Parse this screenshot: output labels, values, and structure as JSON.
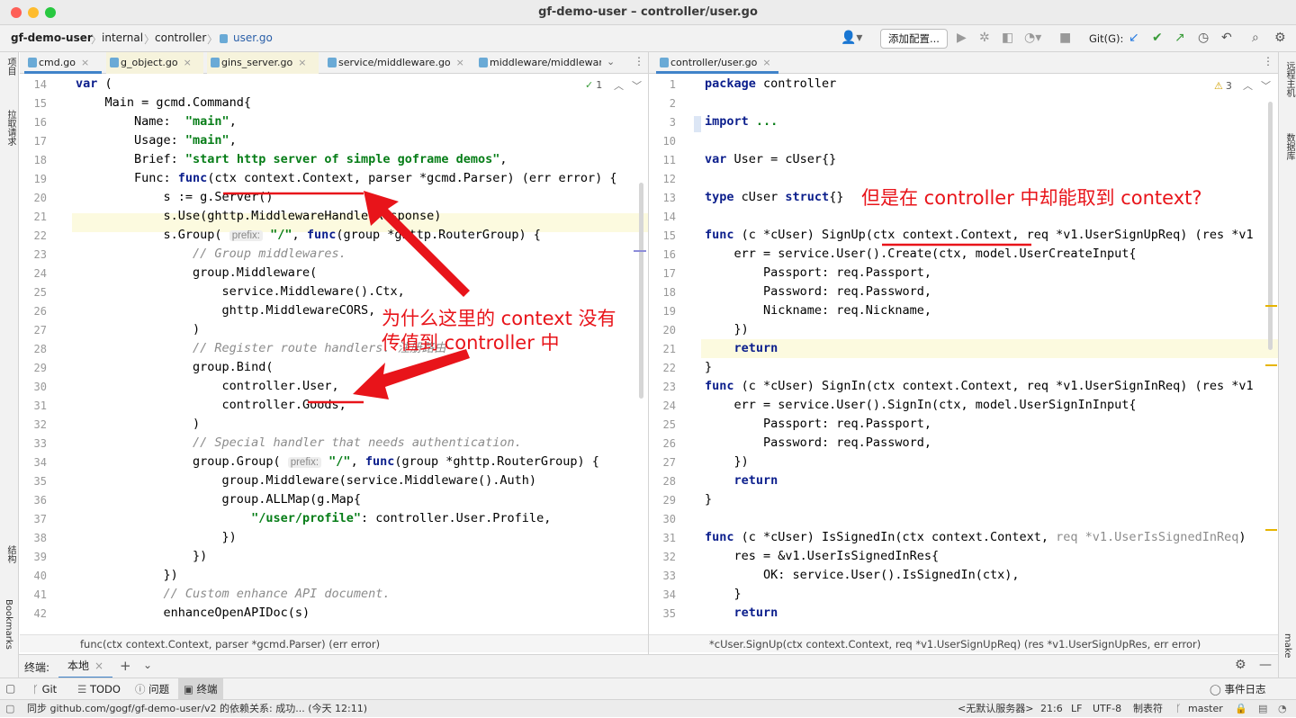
{
  "window": {
    "title": "gf-demo-user – controller/user.go"
  },
  "breadcrumb": [
    "gf-demo-user",
    "internal",
    "controller",
    "user.go"
  ],
  "toolbar": {
    "add_config": "添加配置...",
    "git_label": "Git(G):"
  },
  "left_strip": {
    "project": "项目",
    "pull_requests": "拉取请求",
    "structure": "结构",
    "bookmarks": "Bookmarks"
  },
  "right_strip": {
    "remote_host": "远程主机",
    "database": "数据库",
    "make": "make"
  },
  "left_tabs": [
    {
      "label": "cmd.go"
    },
    {
      "label": "g_object.go"
    },
    {
      "label": "gins_server.go"
    },
    {
      "label": "service/middleware.go"
    },
    {
      "label": "middleware/middlewar"
    }
  ],
  "right_tabs": [
    {
      "label": "controller/user.go"
    }
  ],
  "left_editor": {
    "inspection": "1",
    "current_line": "21",
    "lines": [
      {
        "n": "14",
        "parts": [
          {
            "t": "kw",
            "s": "var"
          },
          {
            "t": "",
            "s": " ("
          }
        ]
      },
      {
        "n": "15",
        "parts": [
          {
            "t": "",
            "s": "    Main = gcmd.Command{"
          }
        ]
      },
      {
        "n": "16",
        "parts": [
          {
            "t": "",
            "s": "        Name:  "
          },
          {
            "t": "str",
            "s": "\"main\""
          },
          {
            "t": "",
            "s": ","
          }
        ]
      },
      {
        "n": "17",
        "parts": [
          {
            "t": "",
            "s": "        Usage: "
          },
          {
            "t": "str",
            "s": "\"main\""
          },
          {
            "t": "",
            "s": ","
          }
        ]
      },
      {
        "n": "18",
        "parts": [
          {
            "t": "",
            "s": "        Brief: "
          },
          {
            "t": "str",
            "s": "\"start http server of simple goframe demos\""
          },
          {
            "t": "",
            "s": ","
          }
        ]
      },
      {
        "n": "19",
        "parts": [
          {
            "t": "",
            "s": "        Func: "
          },
          {
            "t": "kw",
            "s": "func"
          },
          {
            "t": "",
            "s": "(ctx context.Context, parser *gcmd.Parser) (err error) {"
          }
        ]
      },
      {
        "n": "20",
        "parts": [
          {
            "t": "",
            "s": "            s := g.Server()"
          }
        ]
      },
      {
        "n": "21",
        "parts": [
          {
            "t": "",
            "s": "            s.Use(ghttp.MiddlewareHandlerResponse)"
          }
        ]
      },
      {
        "n": "22",
        "parts": [
          {
            "t": "",
            "s": "            s.Group( "
          },
          {
            "t": "hint",
            "s": "prefix:"
          },
          {
            "t": "",
            "s": " "
          },
          {
            "t": "str",
            "s": "\"/\""
          },
          {
            "t": "",
            "s": ", "
          },
          {
            "t": "kw",
            "s": "func"
          },
          {
            "t": "",
            "s": "(group *ghttp.RouterGroup) {"
          }
        ]
      },
      {
        "n": "23",
        "parts": [
          {
            "t": "cmt",
            "s": "                // Group middlewares."
          }
        ]
      },
      {
        "n": "24",
        "parts": [
          {
            "t": "",
            "s": "                group.Middleware("
          }
        ]
      },
      {
        "n": "25",
        "parts": [
          {
            "t": "",
            "s": "                    service.Middleware().Ctx,"
          }
        ]
      },
      {
        "n": "26",
        "parts": [
          {
            "t": "",
            "s": "                    ghttp.MiddlewareCORS,"
          }
        ]
      },
      {
        "n": "27",
        "parts": [
          {
            "t": "",
            "s": "                )"
          }
        ]
      },
      {
        "n": "28",
        "parts": [
          {
            "t": "cmt",
            "s": "                // Register route handlers. 注册路由"
          }
        ]
      },
      {
        "n": "29",
        "parts": [
          {
            "t": "",
            "s": "                group.Bind("
          }
        ]
      },
      {
        "n": "30",
        "parts": [
          {
            "t": "",
            "s": "                    controller.User,"
          }
        ]
      },
      {
        "n": "31",
        "parts": [
          {
            "t": "",
            "s": "                    controller.Goods,"
          }
        ]
      },
      {
        "n": "32",
        "parts": [
          {
            "t": "",
            "s": "                )"
          }
        ]
      },
      {
        "n": "33",
        "parts": [
          {
            "t": "cmt",
            "s": "                // Special handler that needs authentication."
          }
        ]
      },
      {
        "n": "34",
        "parts": [
          {
            "t": "",
            "s": "                group.Group( "
          },
          {
            "t": "hint",
            "s": "prefix:"
          },
          {
            "t": "",
            "s": " "
          },
          {
            "t": "str",
            "s": "\"/\""
          },
          {
            "t": "",
            "s": ", "
          },
          {
            "t": "kw",
            "s": "func"
          },
          {
            "t": "",
            "s": "(group *ghttp.RouterGroup) {"
          }
        ]
      },
      {
        "n": "35",
        "parts": [
          {
            "t": "",
            "s": "                    group.Middleware(service.Middleware().Auth)"
          }
        ]
      },
      {
        "n": "36",
        "parts": [
          {
            "t": "",
            "s": "                    group.ALLMap(g.Map{"
          }
        ]
      },
      {
        "n": "37",
        "parts": [
          {
            "t": "",
            "s": "                        "
          },
          {
            "t": "str",
            "s": "\"/user/profile\""
          },
          {
            "t": "",
            "s": ": controller.User.Profile,"
          }
        ]
      },
      {
        "n": "38",
        "parts": [
          {
            "t": "",
            "s": "                    })"
          }
        ]
      },
      {
        "n": "39",
        "parts": [
          {
            "t": "",
            "s": "                })"
          }
        ]
      },
      {
        "n": "40",
        "parts": [
          {
            "t": "",
            "s": "            })"
          }
        ]
      },
      {
        "n": "41",
        "parts": [
          {
            "t": "cmt",
            "s": "            // Custom enhance API document."
          }
        ]
      },
      {
        "n": "42",
        "parts": [
          {
            "t": "",
            "s": "            enhanceOpenAPIDoc(s)"
          }
        ]
      }
    ],
    "status": "func(ctx context.Context, parser *gcmd.Parser) (err error)"
  },
  "right_editor": {
    "inspection": "3",
    "current_line": "21",
    "lines": [
      {
        "n": "1",
        "parts": [
          {
            "t": "kw",
            "s": "package"
          },
          {
            "t": "",
            "s": " controller"
          }
        ]
      },
      {
        "n": "2",
        "parts": []
      },
      {
        "n": "3",
        "parts": [
          {
            "t": "kw",
            "s": "import"
          },
          {
            "t": "",
            "s": " "
          },
          {
            "t": "str",
            "s": "..."
          }
        ]
      },
      {
        "n": "10",
        "parts": []
      },
      {
        "n": "11",
        "parts": [
          {
            "t": "kw",
            "s": "var"
          },
          {
            "t": "",
            "s": " User = cUser{}"
          }
        ]
      },
      {
        "n": "12",
        "parts": []
      },
      {
        "n": "13",
        "parts": [
          {
            "t": "kw",
            "s": "type"
          },
          {
            "t": "",
            "s": " cUser "
          },
          {
            "t": "kw",
            "s": "struct"
          },
          {
            "t": "",
            "s": "{}"
          }
        ]
      },
      {
        "n": "14",
        "parts": []
      },
      {
        "n": "15",
        "parts": [
          {
            "t": "kw",
            "s": "func"
          },
          {
            "t": "",
            "s": " (c *cUser) SignUp(ctx context.Context, req *v1.UserSignUpReq) (res *v1"
          }
        ]
      },
      {
        "n": "16",
        "parts": [
          {
            "t": "",
            "s": "    err = service.User().Create(ctx, model.UserCreateInput{"
          }
        ]
      },
      {
        "n": "17",
        "parts": [
          {
            "t": "",
            "s": "        Passport: req.Passport,"
          }
        ]
      },
      {
        "n": "18",
        "parts": [
          {
            "t": "",
            "s": "        Password: req.Password,"
          }
        ]
      },
      {
        "n": "19",
        "parts": [
          {
            "t": "",
            "s": "        Nickname: req.Nickname,"
          }
        ]
      },
      {
        "n": "20",
        "parts": [
          {
            "t": "",
            "s": "    })"
          }
        ]
      },
      {
        "n": "21",
        "parts": [
          {
            "t": "",
            "s": "    "
          },
          {
            "t": "kw",
            "s": "return"
          }
        ]
      },
      {
        "n": "22",
        "parts": [
          {
            "t": "",
            "s": "}"
          }
        ]
      },
      {
        "n": "23",
        "parts": [
          {
            "t": "kw",
            "s": "func"
          },
          {
            "t": "",
            "s": " (c *cUser) SignIn(ctx context.Context, req *v1.UserSignInReq) (res *v1"
          }
        ]
      },
      {
        "n": "24",
        "parts": [
          {
            "t": "",
            "s": "    err = service.User().SignIn(ctx, model.UserSignInInput{"
          }
        ]
      },
      {
        "n": "25",
        "parts": [
          {
            "t": "",
            "s": "        Passport: req.Passport,"
          }
        ]
      },
      {
        "n": "26",
        "parts": [
          {
            "t": "",
            "s": "        Password: req.Password,"
          }
        ]
      },
      {
        "n": "27",
        "parts": [
          {
            "t": "",
            "s": "    })"
          }
        ]
      },
      {
        "n": "28",
        "parts": [
          {
            "t": "",
            "s": "    "
          },
          {
            "t": "kw",
            "s": "return"
          }
        ]
      },
      {
        "n": "29",
        "parts": [
          {
            "t": "",
            "s": "}"
          }
        ]
      },
      {
        "n": "30",
        "parts": []
      },
      {
        "n": "31",
        "parts": [
          {
            "t": "kw",
            "s": "func"
          },
          {
            "t": "",
            "s": " (c *cUser) IsSignedIn(ctx context.Context, "
          },
          {
            "t": "grey",
            "s": "req *v1.UserIsSignedInReq"
          },
          {
            "t": "",
            "s": ")"
          }
        ]
      },
      {
        "n": "32",
        "parts": [
          {
            "t": "",
            "s": "    res = &v1.UserIsSignedInRes{"
          }
        ]
      },
      {
        "n": "33",
        "parts": [
          {
            "t": "",
            "s": "        OK: service.User().IsSignedIn(ctx),"
          }
        ]
      },
      {
        "n": "34",
        "parts": [
          {
            "t": "",
            "s": "    }"
          }
        ]
      },
      {
        "n": "35",
        "parts": [
          {
            "t": "",
            "s": "    "
          },
          {
            "t": "kw",
            "s": "return"
          }
        ]
      }
    ],
    "status": "*cUser.SignUp(ctx context.Context, req *v1.UserSignUpReq) (res *v1.UserSignUpRes, err error)"
  },
  "annotations": {
    "left_question": [
      "为什么这里的 context 没有",
      "传值到 controller 中"
    ],
    "right_question": "但是在 controller 中却能取到 context?"
  },
  "terminal": {
    "label": "终端:",
    "tab": "本地"
  },
  "tool_windows": {
    "git": "Git",
    "todo": "TODO",
    "problems": "问题",
    "terminal": "终端",
    "event_log": "事件日志"
  },
  "status_bar": {
    "message": "同步 github.com/gogf/gf-demo-user/v2 的依赖关系: 成功... (今天 12:11)",
    "server": "<无默认服务器>",
    "position": "21:6",
    "line_ending": "LF",
    "encoding": "UTF-8",
    "indent": "制表符",
    "branch": "master"
  },
  "colors": {
    "keyword": "#0b1e8c",
    "string": "#067d17",
    "comment": "#8c8c8c",
    "annotation": "#e8141a",
    "accent": "#4083c9"
  }
}
